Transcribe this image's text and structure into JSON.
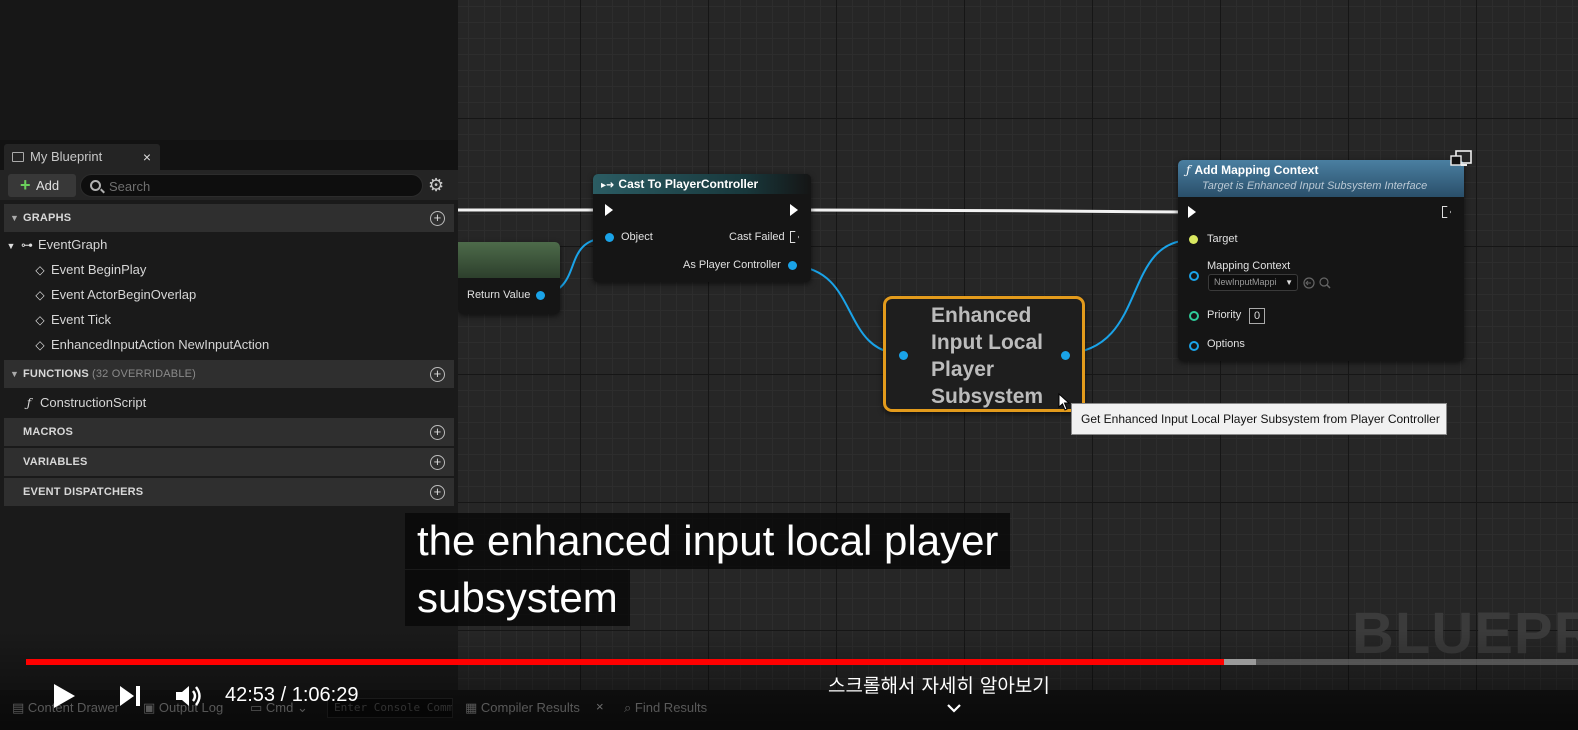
{
  "left_panel": {
    "tab_label": "My Blueprint",
    "tab_close": "×",
    "add_label": "Add",
    "search_placeholder": "Search",
    "sections": {
      "graphs": "GRAPHS",
      "functions": "FUNCTIONS",
      "functions_sub": "(32 OVERRIDABLE)",
      "macros": "MACROS",
      "variables": "VARIABLES",
      "event_dispatchers": "EVENT DISPATCHERS"
    },
    "event_graph": "EventGraph",
    "events": [
      "Event BeginPlay",
      "Event ActorBeginOverlap",
      "Event Tick",
      "EnhancedInputAction NewInputAction"
    ],
    "construction_script": "ConstructionScript"
  },
  "nodes": {
    "cast": {
      "title": "Cast To PlayerController",
      "object": "Object",
      "cast_failed": "Cast Failed",
      "as_player_controller": "As Player Controller"
    },
    "return_value": "Return Value",
    "subsystem": {
      "line1": "Enhanced",
      "line2": "Input Local",
      "line3": "Player",
      "line4": "Subsystem"
    },
    "mapping": {
      "title": "Add Mapping Context",
      "subtitle": "Target is Enhanced Input Subsystem Interface",
      "target": "Target",
      "mapping_context": "Mapping Context",
      "context_value": "NewInputMappi",
      "priority": "Priority",
      "priority_value": "0",
      "options": "Options"
    }
  },
  "tooltip": "Get Enhanced Input Local Player Subsystem from Player Controller",
  "watermark": "BLUEPRI",
  "captions": {
    "line1": "the enhanced input local player",
    "line2": "subsystem"
  },
  "editor_bar": {
    "content_drawer": "Content Drawer",
    "output_log": "Output Log",
    "cmd": "Cmd",
    "console_placeholder": "Enter Console Command",
    "compiler_results": "Compiler Results",
    "close": "×",
    "find_results": "Find Results"
  },
  "video": {
    "time": "42:53 / 1:06:29",
    "progress_fraction": 0.7716,
    "buffered_fraction": 0.7925,
    "scroll_hint": "스크롤해서 자세히 알아보기"
  },
  "colors": {
    "progress": "#ff0000",
    "selection": "#e39b1c",
    "object_pin": "#1aa3e8",
    "target_pin": "#d9e860",
    "priority_pin": "#2ecc9a"
  }
}
